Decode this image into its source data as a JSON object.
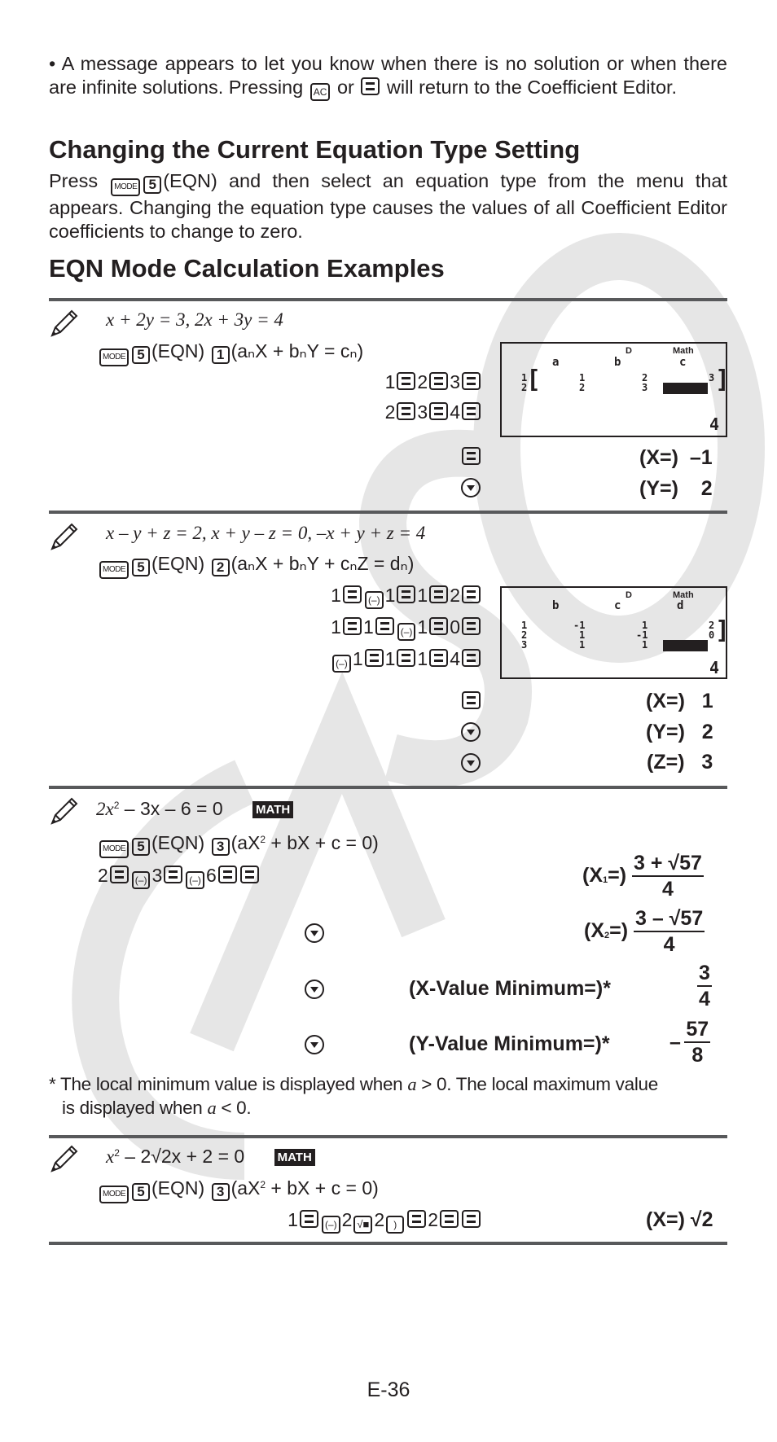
{
  "intro": {
    "bullet": "•",
    "text_a": "A message appears to let you know when there is no solution or when there are infinite solutions. Pressing",
    "key_ac": "AC",
    "text_or": "or",
    "text_b": "will return to the Coefficient Editor."
  },
  "section1": {
    "heading": "Changing the Current Equation Type Setting",
    "text_press": "Press",
    "key_mode": "MODE",
    "key_5": "5",
    "text_rest": "(EQN) and then select an equation type from the menu that appears. Changing the equation type causes the values of all Coefficient Editor coefficients to change to zero."
  },
  "section2": {
    "heading": "EQN Mode Calculation Examples"
  },
  "keys": {
    "mode": "MODE",
    "five": "5",
    "eqn": "(EQN)",
    "one": "1",
    "two": "2",
    "three": "3",
    "neg": "(–)",
    "sqrt": "√■",
    "paren": ")"
  },
  "examples": [
    {
      "equation": "x + 2y = 3, 2x + 3y = 4",
      "type_key": "1",
      "type_label": "(aₙX + bₙY = cₙ)",
      "input_rows": [
        [
          "1",
          "2",
          "3"
        ],
        [
          "2",
          "3",
          "4"
        ]
      ],
      "display": {
        "indicator": "D",
        "mode": "Math",
        "columns": [
          "a",
          "b",
          "c"
        ],
        "row_numbers": [
          "1",
          "2"
        ],
        "cells": [
          [
            "1",
            "2",
            "3"
          ],
          [
            "2",
            "3",
            ""
          ]
        ],
        "bottom_value": "4"
      },
      "results": [
        {
          "key": "equals",
          "label": "(X=)",
          "value": "–1"
        },
        {
          "key": "down",
          "label": "(Y=)",
          "value": "2"
        }
      ]
    },
    {
      "equation": "x – y + z = 2, x + y – z = 0, –x + y + z = 4",
      "type_key": "2",
      "type_label": "(aₙX + bₙY + cₙZ = dₙ)",
      "input_rows": [
        "1 = (–) 1 = 1 = 2 =",
        "1 = 1 = (–) 1 = 0 =",
        "(–) 1 = 1 = 1 = 4 ="
      ],
      "display": {
        "indicator": "D",
        "mode": "Math",
        "columns": [
          "b",
          "c",
          "d"
        ],
        "row_numbers": [
          "1",
          "2",
          "3"
        ],
        "cells": [
          [
            "-1",
            "1",
            "2"
          ],
          [
            "1",
            "-1",
            "0"
          ],
          [
            "1",
            "1",
            ""
          ]
        ],
        "bottom_value": "4"
      },
      "results": [
        {
          "key": "equals",
          "label": "(X=)",
          "value": "1"
        },
        {
          "key": "down",
          "label": "(Y=)",
          "value": "2"
        },
        {
          "key": "down",
          "label": "(Z=)",
          "value": "3"
        }
      ]
    },
    {
      "equation_parts": [
        "2x",
        "2",
        " – 3x – 6 = 0"
      ],
      "badge": "MATH",
      "type_key": "3",
      "type_label_a": "(aX",
      "type_label_sup": "2",
      "type_label_b": " + bX + c = 0)",
      "input": [
        "2",
        "(–)",
        "3",
        "(–)",
        "6"
      ],
      "results": [
        {
          "key": "none",
          "label": "(X",
          "sub": "1",
          "label_end": "=)",
          "num": "3 + √57",
          "den": "4",
          "sign": ""
        },
        {
          "key": "down",
          "label": "(X",
          "sub": "2",
          "label_end": "=)",
          "num": "3 – √57",
          "den": "4",
          "sign": ""
        },
        {
          "key": "down",
          "label": "(X-Value Minimum=)*",
          "num": "3",
          "den": "4",
          "sign": ""
        },
        {
          "key": "down",
          "label": "(Y-Value Minimum=)*",
          "num": "57",
          "den": "8",
          "sign": "–"
        }
      ],
      "footnote": "* The local minimum value is displayed when a > 0. The local maximum value is displayed when a < 0."
    },
    {
      "equation_parts": [
        "x",
        "2",
        " – 2√2x + 2 = 0"
      ],
      "badge": "MATH",
      "type_key": "3",
      "type_label_a": "(aX",
      "type_label_sup": "2",
      "type_label_b": " + bX + c = 0)",
      "input": [
        "1",
        "(–)",
        "2",
        "√■",
        "2",
        ")",
        "2"
      ],
      "results": [
        {
          "key": "none",
          "label": "(X=)",
          "value": "√2"
        }
      ]
    }
  ],
  "footnote_parts": {
    "a": "* The local minimum value is displayed when",
    "var": "a",
    "gt": " > 0. The local maximum value",
    "b": "is displayed when",
    "lt": " < 0."
  },
  "watermark": "CASIO",
  "page_number": "E-36"
}
